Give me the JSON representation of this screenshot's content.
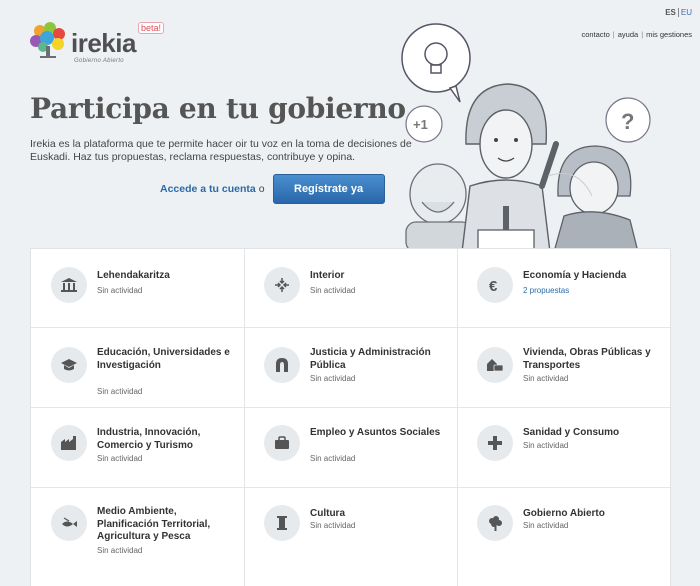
{
  "header": {
    "logo_text": "irekia",
    "logo_badge": "beta!",
    "logo_tagline": "Gobierno Abierto",
    "languages": [
      "ES",
      "EU"
    ],
    "links": [
      "contacto",
      "ayuda",
      "mis gestiones"
    ]
  },
  "hero": {
    "title": "Participa en tu gobierno.",
    "description": "Irekia es la plataforma que te permite hacer oir tu voz en la toma de decisiones de Euskadi. Haz tus propuestas, reclama respuestas, contribuye y opina.",
    "login_link": "Accede a tu cuenta",
    "or_text": "o",
    "register_button": "Regístrate ya",
    "bubble_plus": "+1",
    "bubble_question": "?"
  },
  "departments": [
    {
      "name": "Lehendakaritza",
      "status": "Sin actividad",
      "icon": "building-icon"
    },
    {
      "name": "Interior",
      "status": "Sin actividad",
      "icon": "arrows-in-icon"
    },
    {
      "name": "Economía y Hacienda",
      "status": "2 propuestas",
      "icon": "euro-icon"
    },
    {
      "name": "Educación, Universidades e Investigación",
      "status": "Sin actividad",
      "icon": "graduation-cap-icon"
    },
    {
      "name": "Justicia y Administración Pública",
      "status": "Sin actividad",
      "icon": "arch-icon"
    },
    {
      "name": "Vivienda, Obras Públicas y Transportes",
      "status": "Sin actividad",
      "icon": "house-bus-icon"
    },
    {
      "name": "Industria, Innovación, Comercio y Turismo",
      "status": "Sin actividad",
      "icon": "factory-icon"
    },
    {
      "name": "Empleo y Asuntos Sociales",
      "status": "Sin actividad",
      "icon": "briefcase-icon"
    },
    {
      "name": "Sanidad y Consumo",
      "status": "Sin actividad",
      "icon": "cross-icon"
    },
    {
      "name": "Medio Ambiente, Planificación Territorial, Agricultura y Pesca",
      "status": "Sin actividad",
      "icon": "fish-icon"
    },
    {
      "name": "Cultura",
      "status": "Sin actividad",
      "icon": "column-icon"
    },
    {
      "name": "Gobierno Abierto",
      "status": "Sin actividad",
      "icon": "tree-icon"
    }
  ],
  "colors": {
    "accent_blue": "#2b6aa6",
    "button_blue": "#3a7cbf",
    "background": "#eef1f3",
    "beta_red": "#e24b58"
  }
}
